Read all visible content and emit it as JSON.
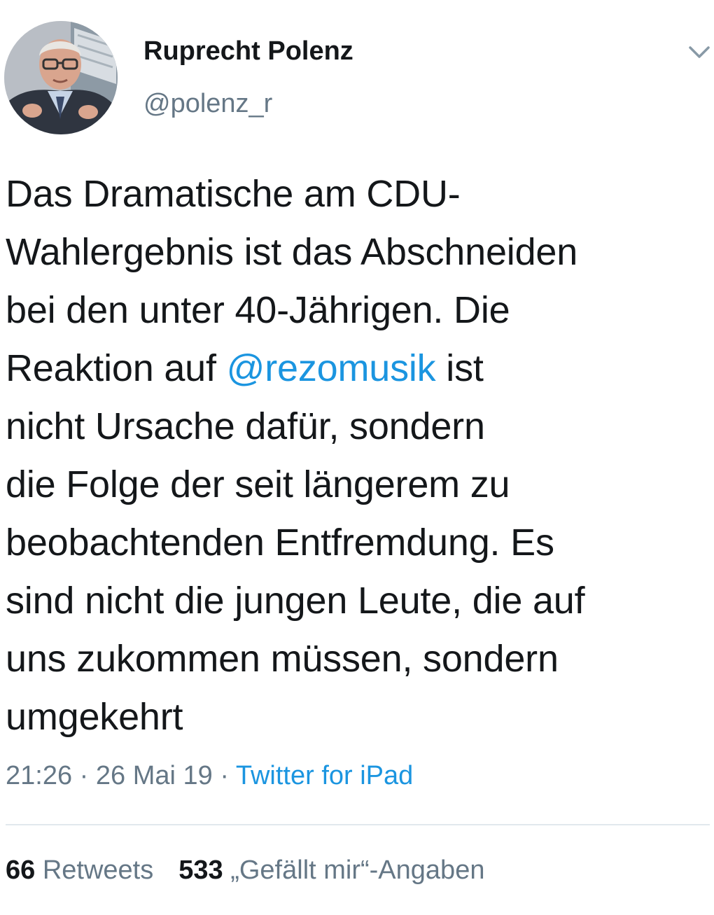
{
  "author": {
    "name": "Ruprecht Polenz",
    "handle": "@polenz_r"
  },
  "icons": {
    "menu": "chevron-down-icon",
    "avatar": "profile-photo"
  },
  "tweet": {
    "lines": [
      "Das Dramatische am CDU-",
      "Wahlergebnis ist das Abschneiden",
      "bei den unter 40-Jährigen. Die",
      "Reaktion auf ",
      "nicht Ursache dafür, sondern",
      "die Folge der seit längerem zu",
      "beobachtenden Entfremdung. Es",
      "sind nicht die jungen Leute, die auf",
      "uns zukommen müssen, sondern",
      "umgekehrt"
    ],
    "mention": "@rezomusik",
    "after_mention": " ist"
  },
  "meta": {
    "time": "21:26",
    "date": "26 Mai 19",
    "separator": " · ",
    "source": "Twitter for iPad"
  },
  "stats": {
    "retweets_count": "66",
    "retweets_label": " Retweets",
    "likes_count": "533",
    "likes_label": " „Gefällt mir“-Angaben"
  },
  "colors": {
    "link": "#1b95e0",
    "secondary_text": "#657786",
    "primary_text": "#14171a",
    "divider": "#e1e8ed"
  }
}
